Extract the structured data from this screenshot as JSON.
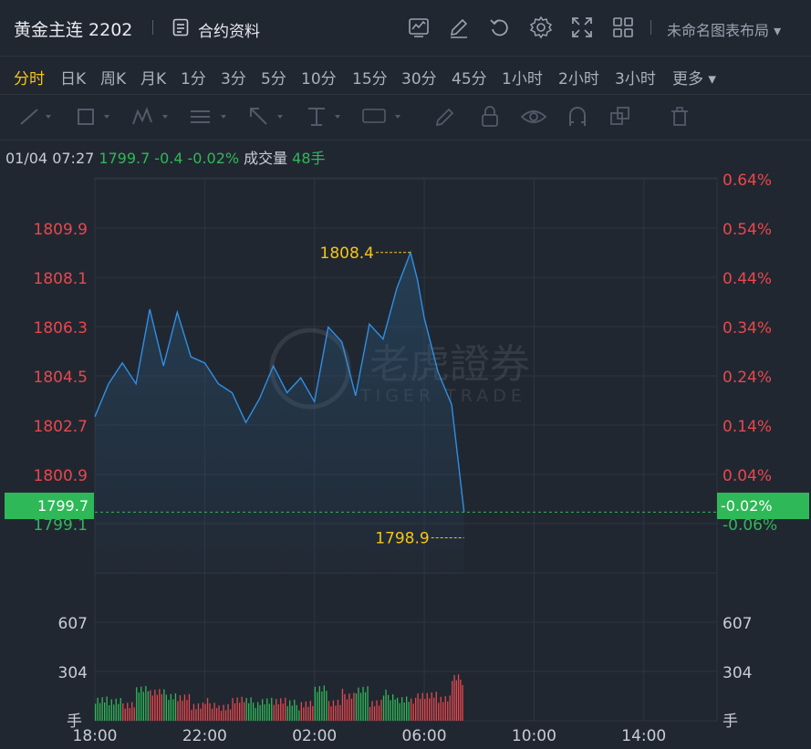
{
  "header": {
    "symbol": "黄金主连 2202",
    "contract_info_label": "合约资料",
    "toolbar_icons": [
      "chart-settings-icon",
      "edit-icon",
      "undo-icon",
      "gear-icon",
      "fullscreen-icon",
      "layout-grid-icon"
    ],
    "layout_name": "未命名图表布局 ▾"
  },
  "tabs": [
    "分时",
    "日K",
    "周K",
    "月K",
    "1分",
    "3分",
    "5分",
    "10分",
    "15分",
    "30分",
    "45分",
    "1小时",
    "2小时",
    "3小时",
    "更多 ▾"
  ],
  "active_tab": "分时",
  "draw_tools": [
    "line-tool-icon",
    "rect-tool-icon",
    "wave-tool-icon",
    "fib-tool-icon",
    "arrow-tool-icon",
    "text-tool-icon",
    "label-tool-icon",
    "pen-icon",
    "lock-icon",
    "eye-icon",
    "magnet-icon",
    "copy-icon",
    "trash-icon"
  ],
  "info": {
    "datetime": "01/04 07:27",
    "price": "1799.7",
    "change": "-0.4",
    "change_pct": "-0.02%",
    "volume_label": "成交量",
    "volume": "48手"
  },
  "colors": {
    "up": "#e8474c",
    "down": "#2fb857",
    "line": "#2f8fe3",
    "accent": "#f5c518"
  },
  "watermark": {
    "cn": "老虎證券",
    "en": "TIGER TRADE"
  },
  "chart_data": {
    "type": "area",
    "x_ticks": [
      "18:00",
      "22:00",
      "02:00",
      "06:00",
      "10:00",
      "14:00"
    ],
    "y_ticks_left": [
      "1809.9",
      "1808.1",
      "1806.3",
      "1804.5",
      "1802.7",
      "1800.9",
      "1799.1"
    ],
    "y_ticks_right": [
      "0.64%",
      "0.54%",
      "0.44%",
      "0.34%",
      "0.24%",
      "0.14%",
      "0.04%",
      "-0.06%"
    ],
    "current_price": "1799.7",
    "current_pct": "-0.02%",
    "high_label": "1808.4",
    "low_label": "1798.9",
    "ylim": [
      1797.6,
      1810.9
    ],
    "series": [
      {
        "x": [
          "18:00",
          "18:30",
          "19:00",
          "19:30",
          "20:00",
          "20:30",
          "21:00",
          "21:30",
          "22:00",
          "22:30",
          "23:00",
          "23:30",
          "00:00",
          "00:30",
          "01:00",
          "01:30",
          "02:00",
          "02:30",
          "03:00",
          "03:30",
          "04:00",
          "04:30",
          "05:00",
          "05:30",
          "05:45",
          "06:00",
          "06:30",
          "07:00",
          "07:27"
        ],
        "values": [
          1802.9,
          1804.0,
          1804.7,
          1804.0,
          1806.5,
          1804.6,
          1806.4,
          1804.9,
          1804.7,
          1804.0,
          1803.7,
          1802.7,
          1803.5,
          1804.6,
          1803.7,
          1804.2,
          1803.4,
          1805.9,
          1805.4,
          1803.6,
          1806.0,
          1805.5,
          1807.2,
          1808.4,
          1807.5,
          1806.2,
          1804.4,
          1803.3,
          1799.7
        ]
      }
    ],
    "volume": {
      "y_ticks": [
        "607",
        "304"
      ],
      "unit": "手",
      "ylim": [
        0,
        911
      ]
    }
  }
}
